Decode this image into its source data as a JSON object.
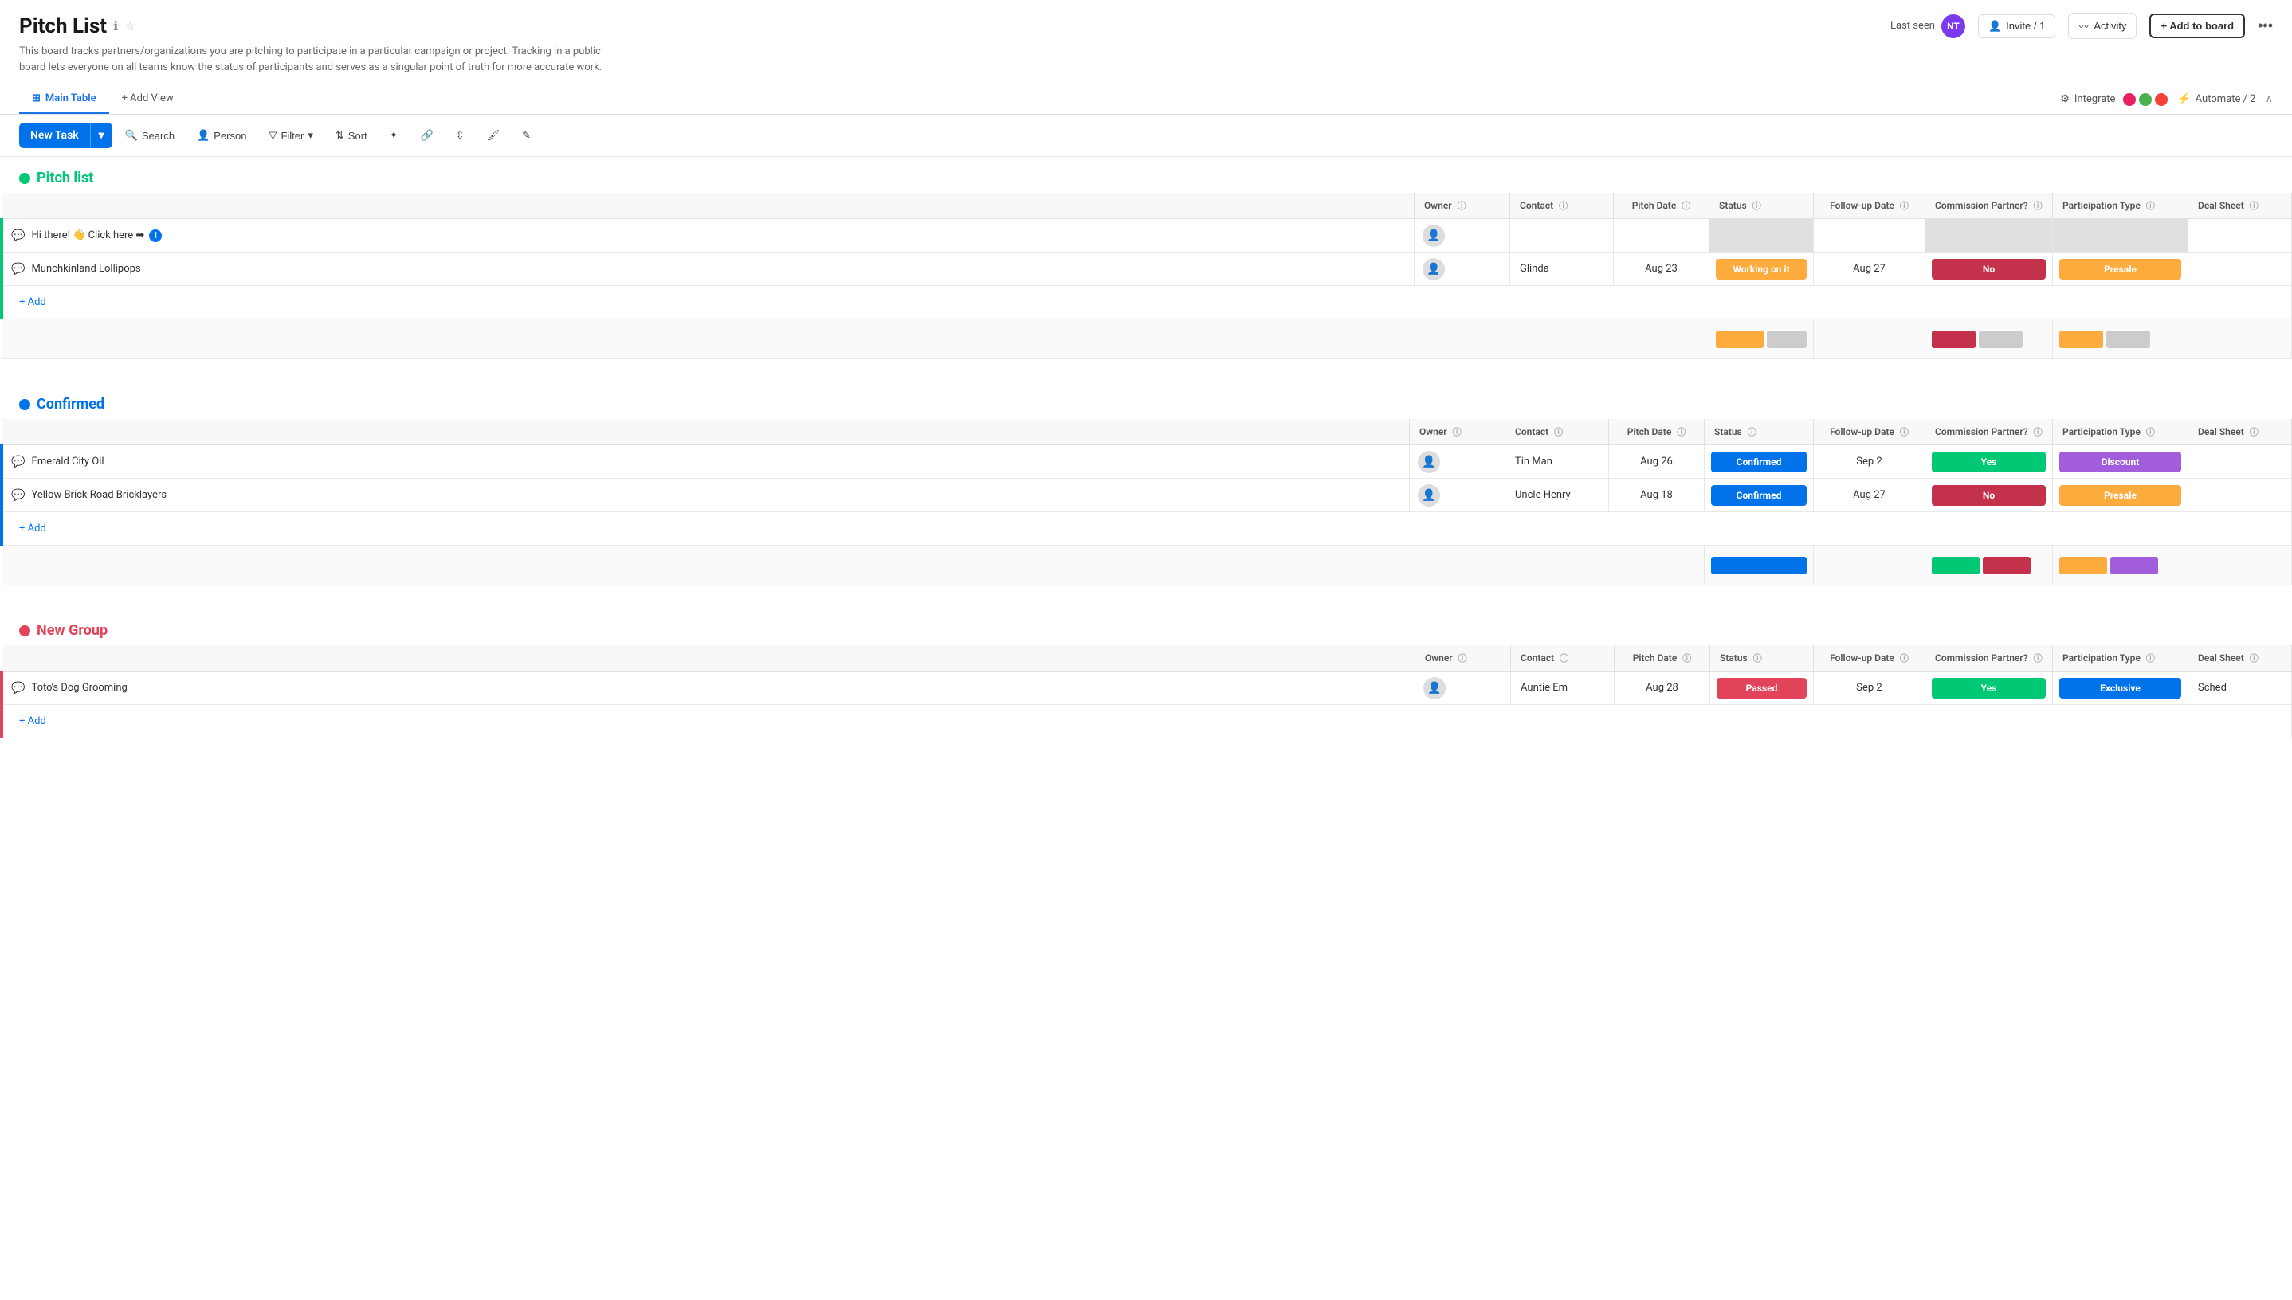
{
  "header": {
    "title": "Pitch List",
    "subtitle": "This board tracks partners/organizations you are pitching to participate in a particular campaign or project. Tracking in a public board lets everyone on all teams know the status of participants and serves as a singular point of truth for more accurate work.",
    "last_seen_label": "Last seen",
    "avatar_initials": "NT",
    "invite_label": "Invite / 1",
    "activity_label": "Activity",
    "add_to_board_label": "+ Add to board"
  },
  "tabs": {
    "main_table": "Main Table",
    "add_view": "+ Add View",
    "integrate": "Integrate",
    "automate": "Automate / 2"
  },
  "toolbar": {
    "new_task": "New Task",
    "search": "Search",
    "person": "Person",
    "filter": "Filter",
    "sort": "Sort"
  },
  "columns": {
    "owner": "Owner",
    "contact": "Contact",
    "pitch_date": "Pitch Date",
    "status": "Status",
    "followup_date": "Follow-up Date",
    "commission": "Commission Partner?",
    "participation": "Participation Type",
    "deal_sheet": "Deal Sheet"
  },
  "groups": [
    {
      "id": "pitch-list",
      "name": "Pitch list",
      "color": "green",
      "rows": [
        {
          "name": "Hi there! 👋 Click here ➡",
          "owner": "",
          "contact": "",
          "pitch_date": "",
          "status": "",
          "status_color": "",
          "followup_date": "",
          "commission": "",
          "commission_color": "",
          "participation": "",
          "participation_color": "",
          "deal_sheet": ""
        },
        {
          "name": "Munchkinland Lollipops",
          "owner": "",
          "contact": "Glinda",
          "pitch_date": "Aug 23",
          "status": "Working on it",
          "status_color": "working",
          "followup_date": "Aug 27",
          "commission": "No",
          "commission_color": "no",
          "participation": "Presale",
          "participation_color": "presale",
          "deal_sheet": ""
        }
      ],
      "chart": {
        "status_bars": [
          {
            "color": "#fdab3d",
            "width": 60
          },
          {
            "color": "#ccc",
            "width": 50
          }
        ],
        "commission_bars": [
          {
            "color": "#c4314b",
            "width": 55
          },
          {
            "color": "#ccc",
            "width": 55
          }
        ],
        "participation_bars": [
          {
            "color": "#fdab3d",
            "width": 55
          },
          {
            "color": "#ccc",
            "width": 55
          }
        ]
      }
    },
    {
      "id": "confirmed",
      "name": "Confirmed",
      "color": "blue",
      "rows": [
        {
          "name": "Emerald City Oil",
          "owner": "",
          "contact": "Tin Man",
          "pitch_date": "Aug 26",
          "status": "Confirmed",
          "status_color": "confirmed",
          "followup_date": "Sep 2",
          "commission": "Yes",
          "commission_color": "yes",
          "participation": "Discount",
          "participation_color": "discount",
          "deal_sheet": ""
        },
        {
          "name": "Yellow Brick Road Bricklayers",
          "owner": "",
          "contact": "Uncle Henry",
          "pitch_date": "Aug 18",
          "status": "Confirmed",
          "status_color": "confirmed",
          "followup_date": "Aug 27",
          "commission": "No",
          "commission_color": "no",
          "participation": "Presale",
          "participation_color": "presale",
          "deal_sheet": ""
        }
      ],
      "chart": {
        "status_bars": [
          {
            "color": "#0073ea",
            "width": 120
          }
        ],
        "commission_bars": [
          {
            "color": "#00c875",
            "width": 60
          },
          {
            "color": "#c4314b",
            "width": 60
          }
        ],
        "participation_bars": [
          {
            "color": "#fdab3d",
            "width": 60
          },
          {
            "color": "#a25ddc",
            "width": 60
          }
        ]
      }
    },
    {
      "id": "new-group",
      "name": "New Group",
      "color": "red",
      "rows": [
        {
          "name": "Toto's Dog Grooming",
          "owner": "",
          "contact": "Auntie Em",
          "pitch_date": "Aug 28",
          "status": "Passed",
          "status_color": "passed",
          "followup_date": "Sep 2",
          "commission": "Yes",
          "commission_color": "yes",
          "participation": "Exclusive",
          "participation_color": "exclusive",
          "deal_sheet": "Sched"
        }
      ]
    }
  ]
}
